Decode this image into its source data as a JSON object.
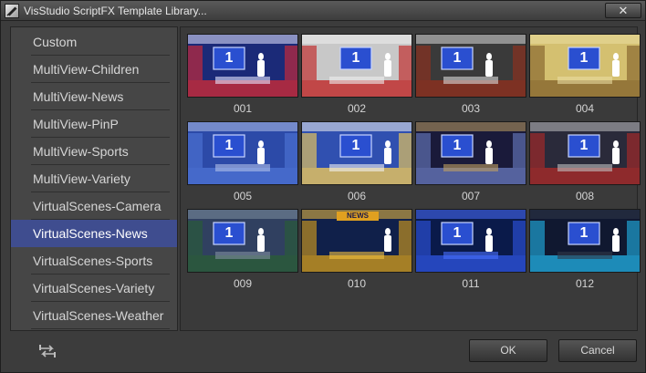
{
  "window": {
    "title": "VisStudio ScriptFX Template Library..."
  },
  "close_label": "✕",
  "categories": [
    "Custom",
    "MultiView-Children",
    "MultiView-News",
    "MultiView-PinP",
    "MultiView-Sports",
    "MultiView-Variety",
    "VirtualScenes-Camera",
    "VirtualScenes-News",
    "VirtualScenes-Sports",
    "VirtualScenes-Variety",
    "VirtualScenes-Weather"
  ],
  "selected_category": "VirtualScenes-News",
  "templates": [
    {
      "label": "001",
      "screen_text": "1"
    },
    {
      "label": "002",
      "screen_text": "1"
    },
    {
      "label": "003",
      "screen_text": "1"
    },
    {
      "label": "004",
      "screen_text": "1"
    },
    {
      "label": "005",
      "screen_text": "1"
    },
    {
      "label": "006",
      "screen_text": "1"
    },
    {
      "label": "007",
      "screen_text": "1"
    },
    {
      "label": "008",
      "screen_text": "1"
    },
    {
      "label": "009",
      "screen_text": "1"
    },
    {
      "label": "010",
      "screen_text": "NEWS"
    },
    {
      "label": "011",
      "screen_text": "1"
    },
    {
      "label": "012",
      "screen_text": "1"
    }
  ],
  "buttons": {
    "ok": "OK",
    "cancel": "Cancel"
  },
  "icons": {
    "refresh": "refresh-icon",
    "app": "app-icon",
    "close": "close-icon"
  },
  "colors": {
    "selection": "#3f4d8f",
    "screen_blue": "#2a4fd0"
  }
}
